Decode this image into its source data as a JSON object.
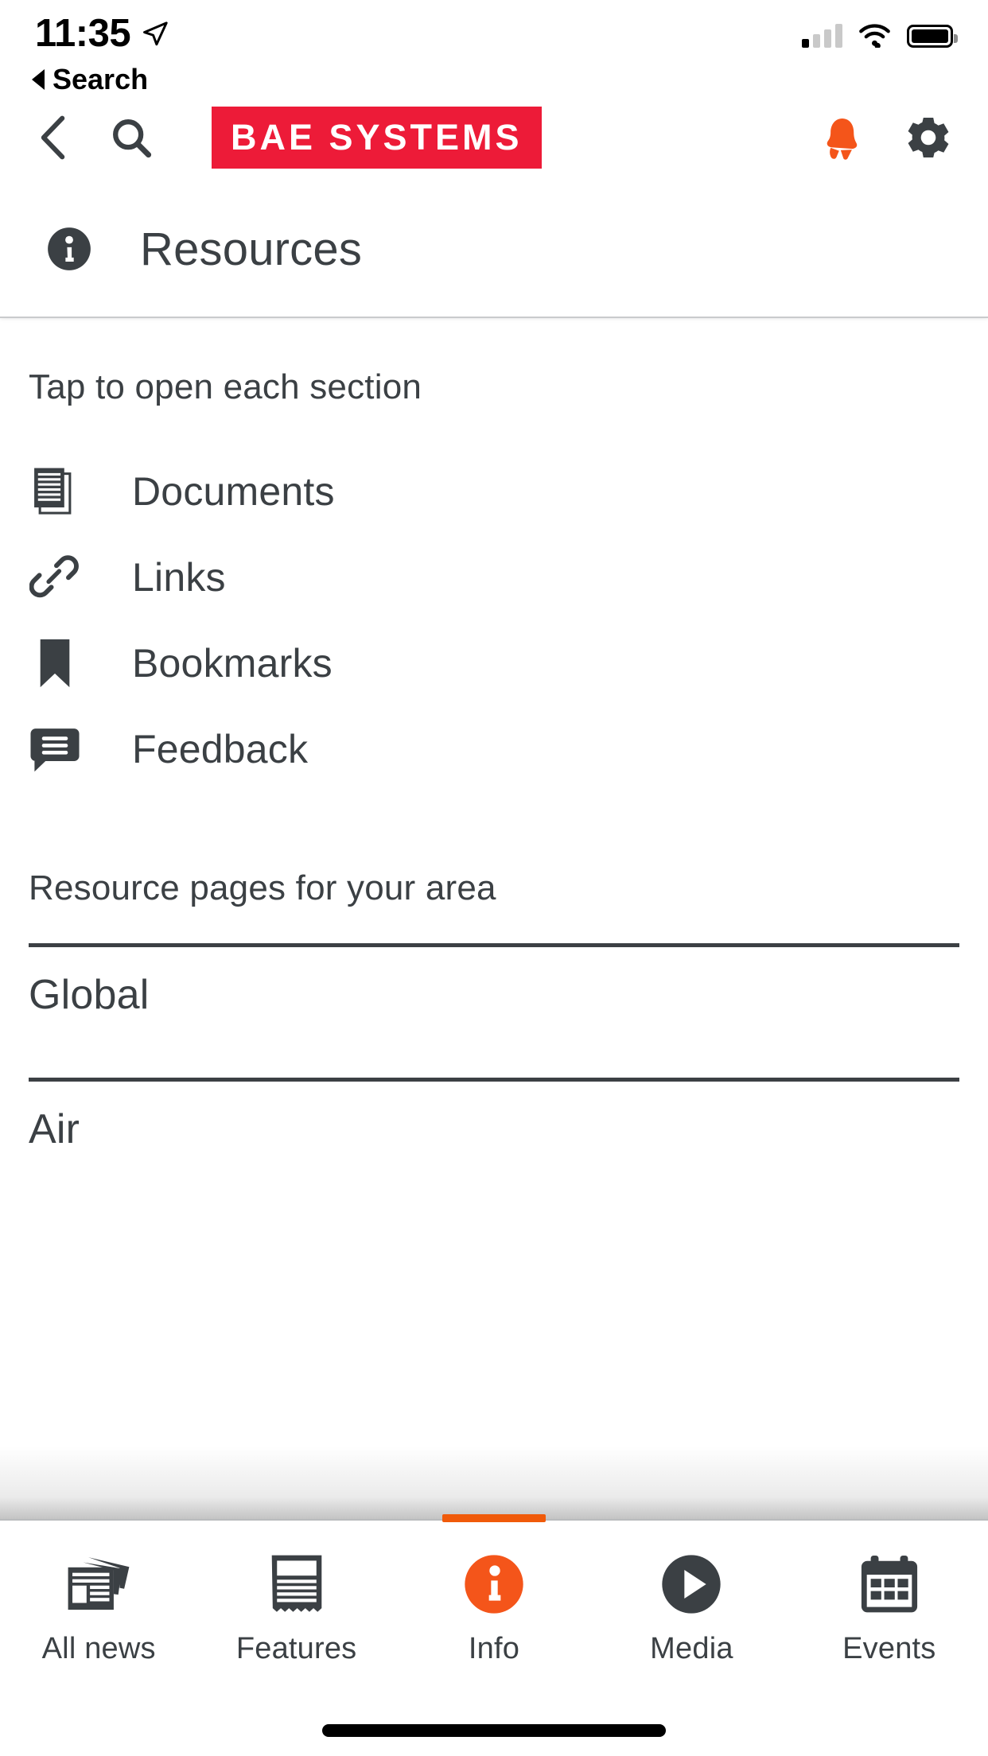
{
  "status_bar": {
    "time": "11:35",
    "location_icon": "location-arrow-icon",
    "back_label": "Search",
    "signal_icon": "cellular-signal-icon",
    "wifi_icon": "wifi-icon",
    "battery_icon": "battery-full-icon"
  },
  "navbar": {
    "back_icon": "chevron-left-icon",
    "search_icon": "search-icon",
    "logo_text": "BAE SYSTEMS",
    "logo_bg": "#ED1B38",
    "notifications_icon": "bell-icon",
    "notifications_color": "#F4551A",
    "settings_icon": "gear-icon"
  },
  "section": {
    "icon": "info-circle-icon",
    "title": "Resources"
  },
  "main": {
    "hint": "Tap to open each section",
    "menu": [
      {
        "label": "Documents",
        "icon": "documents-icon"
      },
      {
        "label": "Links",
        "icon": "link-chain-icon"
      },
      {
        "label": "Bookmarks",
        "icon": "bookmark-icon"
      },
      {
        "label": "Feedback",
        "icon": "speech-bubble-icon"
      }
    ],
    "area_title": "Resource pages for your area",
    "areas": [
      {
        "label": "Global"
      },
      {
        "label": "Air"
      }
    ]
  },
  "tabbar": {
    "active_color": "#F05A0A",
    "tabs": [
      {
        "label": "All news",
        "icon": "newspapers-icon",
        "active": false
      },
      {
        "label": "Features",
        "icon": "article-icon",
        "active": false
      },
      {
        "label": "Info",
        "icon": "info-circle-filled-icon",
        "active": true
      },
      {
        "label": "Media",
        "icon": "play-circle-icon",
        "active": false
      },
      {
        "label": "Events",
        "icon": "calendar-icon",
        "active": false
      }
    ]
  },
  "home_indicator": "home-indicator-bar"
}
